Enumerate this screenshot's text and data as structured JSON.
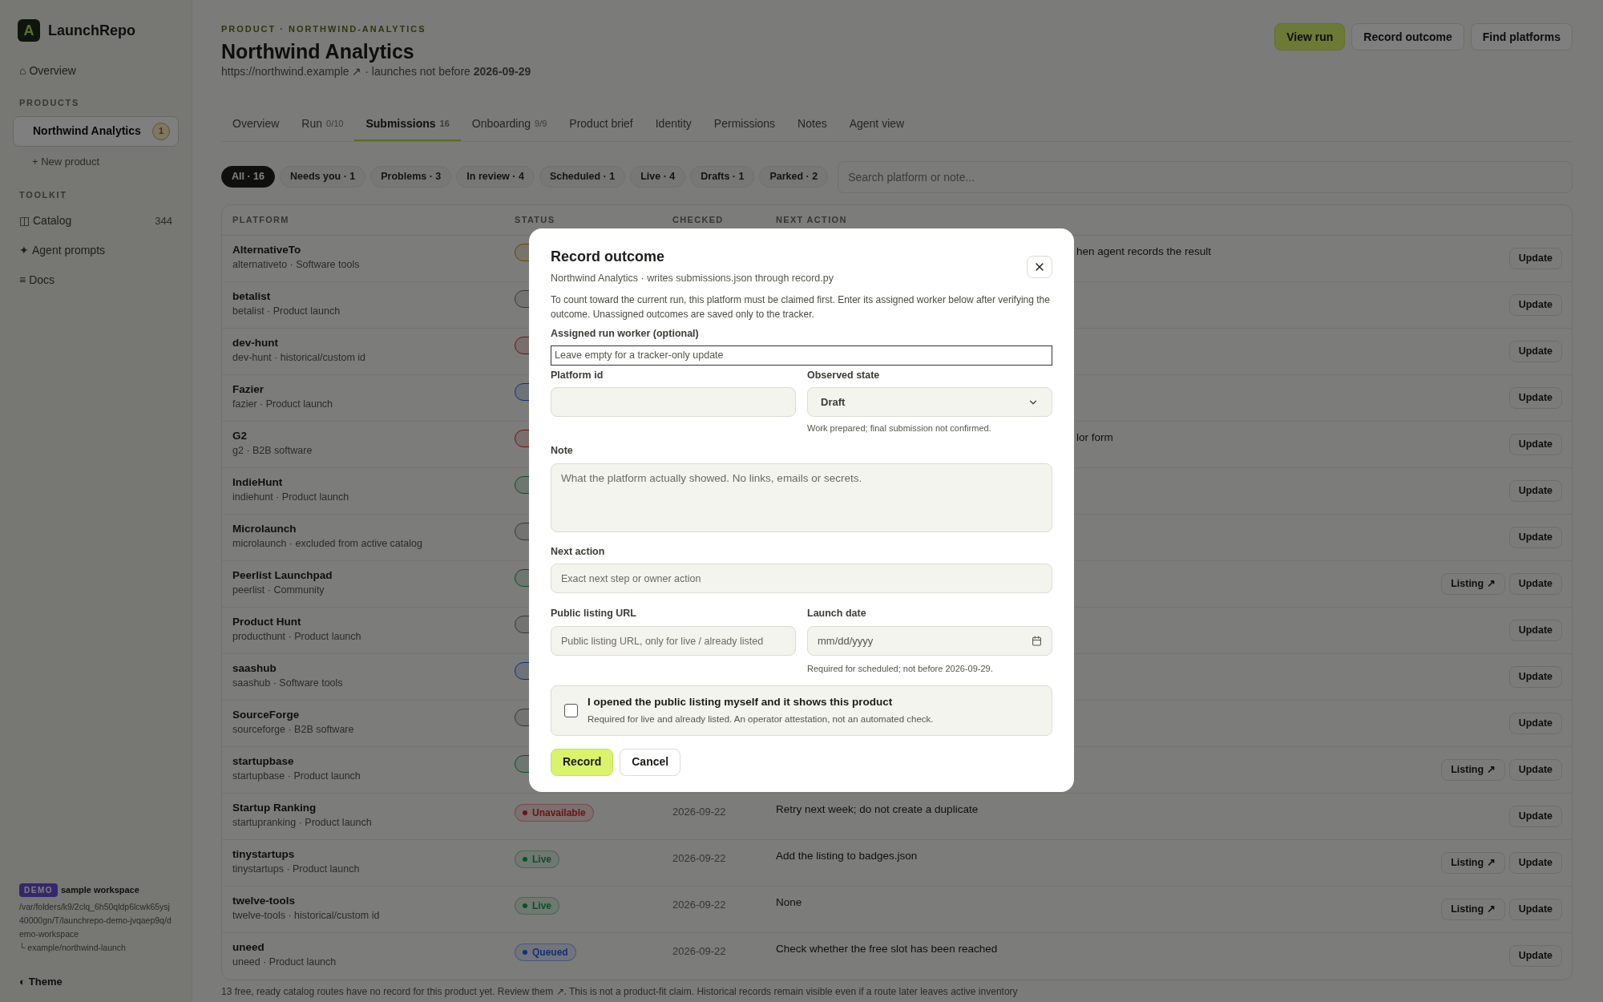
{
  "sidebar": {
    "brand": {
      "mark": "A",
      "name": "LaunchRepo"
    },
    "top_items": [
      {
        "icon": "⌂",
        "label": "Overview"
      }
    ],
    "products_heading": "PRODUCTS",
    "products": [
      {
        "label": "Northwind Analytics",
        "badge": "1",
        "selected": true
      }
    ],
    "new_product": "+ New product",
    "toolkit_heading": "TOOLKIT",
    "toolkit": [
      {
        "icon": "◫",
        "label": "Catalog",
        "count": "344"
      },
      {
        "icon": "✦",
        "label": "Agent prompts"
      },
      {
        "icon": "≡",
        "label": "Docs"
      }
    ],
    "workspace": {
      "badge": "DEMO",
      "title": "sample workspace",
      "path": "/var/folders/k9/2clq_6h50qldp6lcwk65ysj40000gn/T/launchrepo-demo-jvqaep9q/demo-workspace",
      "repo": "└ example/northwind-launch"
    },
    "theme": {
      "icon": "◐",
      "label": "Theme"
    }
  },
  "header": {
    "eyebrow": "PRODUCT · NORTHWIND-ANALYTICS",
    "title": "Northwind Analytics",
    "link": "https://northwind.example ↗",
    "meta": " · launches not before **2026-09-29**",
    "buttons": [
      {
        "label": "View run",
        "kind": "primary"
      },
      {
        "label": "Record outcome",
        "kind": "secondary"
      },
      {
        "label": "Find platforms",
        "kind": "secondary"
      }
    ]
  },
  "tabs": [
    {
      "label": "Overview",
      "selected": false
    },
    {
      "label": "Run",
      "count": "0/10",
      "selected": false
    },
    {
      "label": "Submissions",
      "count": "16",
      "selected": true
    },
    {
      "label": "Onboarding",
      "count": "9/9",
      "selected": false
    },
    {
      "label": "Product brief",
      "selected": false
    },
    {
      "label": "Identity",
      "selected": false
    },
    {
      "label": "Permissions",
      "selected": false
    },
    {
      "label": "Notes",
      "selected": false
    },
    {
      "label": "Agent view",
      "selected": false
    }
  ],
  "filters": [
    {
      "label": "All · 16",
      "selected": true
    },
    {
      "label": "Needs you · 1",
      "selected": false
    },
    {
      "label": "Problems · 3",
      "selected": false
    },
    {
      "label": "In review · 4",
      "selected": false
    },
    {
      "label": "Scheduled · 1",
      "selected": false
    },
    {
      "label": "Live · 4",
      "selected": false
    },
    {
      "label": "Drafts · 1",
      "selected": false
    },
    {
      "label": "Parked · 2",
      "selected": false
    }
  ],
  "search": {
    "placeholder": "Search platform or note..."
  },
  "table": {
    "columns": [
      "PLATFORM",
      "STATUS",
      "CHECKED",
      "NEXT ACTION"
    ],
    "rows": [
      {
        "name": "AlternativeTo",
        "sub": "alternativeto · Software tools",
        "status": {
          "kind": "warning"
        },
        "next_action_tail": "hen agent records the result",
        "actions": [
          "Update"
        ]
      },
      {
        "name": "betalist",
        "sub": "betalist · Product launch",
        "status": {
          "kind": "neutral"
        },
        "actions": [
          "Update"
        ]
      },
      {
        "name": "dev-hunt",
        "sub": "dev-hunt · historical/custom id",
        "status": {
          "kind": "danger"
        },
        "actions": [
          "Update"
        ]
      },
      {
        "name": "Fazier",
        "sub": "fazier · Product launch",
        "status": {
          "kind": "info"
        },
        "actions": [
          "Update"
        ]
      },
      {
        "name": "G2",
        "sub": "g2 · B2B software",
        "status": {
          "kind": "danger"
        },
        "next_action_tail": "lor form",
        "actions": [
          "Update"
        ]
      },
      {
        "name": "IndieHunt",
        "sub": "indiehunt · Product launch",
        "status": {
          "kind": "success"
        },
        "actions": [
          "Update"
        ]
      },
      {
        "name": "Microlaunch",
        "sub": "microlaunch · excluded from active catalog",
        "status": {
          "kind": "neutral"
        },
        "actions": [
          "Update"
        ]
      },
      {
        "name": "Peerlist Launchpad",
        "sub": "peerlist · Community",
        "status": {
          "kind": "success"
        },
        "actions": [
          "Listing ↗",
          "Update"
        ]
      },
      {
        "name": "Product Hunt",
        "sub": "producthunt · Product launch",
        "status": {
          "kind": "neutral"
        },
        "actions": [
          "Update"
        ]
      },
      {
        "name": "saashub",
        "sub": "saashub · Software tools",
        "status": {
          "kind": "info"
        },
        "actions": [
          "Update"
        ]
      },
      {
        "name": "SourceForge",
        "sub": "sourceforge · B2B software",
        "status": {
          "kind": "neutral"
        },
        "actions": [
          "Update"
        ]
      },
      {
        "name": "startupbase",
        "sub": "startupbase · Product launch",
        "status": {
          "kind": "success"
        },
        "actions": [
          "Listing ↗",
          "Update"
        ]
      },
      {
        "name": "Startup Ranking",
        "sub": "startupranking · Product launch",
        "status": {
          "label": "Unavailable",
          "kind": "danger"
        },
        "checked": "2026-09-22",
        "next_action": "Retry next week; do not create a duplicate",
        "actions": [
          "Update"
        ]
      },
      {
        "name": "tinystartups",
        "sub": "tinystartups · Product launch",
        "status": {
          "label": "Live",
          "kind": "success"
        },
        "checked": "2026-09-22",
        "next_action": "Add the listing to badges.json",
        "actions": [
          "Listing ↗",
          "Update"
        ]
      },
      {
        "name": "twelve-tools",
        "sub": "twelve-tools · historical/custom id",
        "status": {
          "label": "Live",
          "kind": "success"
        },
        "checked": "2026-09-22",
        "next_action": "None",
        "actions": [
          "Listing ↗",
          "Update"
        ]
      },
      {
        "name": "uneed",
        "sub": "uneed · Product launch",
        "status": {
          "label": "Queued",
          "kind": "info"
        },
        "checked": "2026-09-22",
        "next_action": "Check whether the free slot has been reached",
        "actions": [
          "Update"
        ]
      }
    ]
  },
  "footer_note": "13 free, ready catalog routes have no record for this product yet. Review them ↗. This is not a product-fit claim. Historical records remain visible even if a route later leaves active inventory",
  "dialog": {
    "title": "Record outcome",
    "subtitle": "Northwind Analytics · writes submissions.json through record.py",
    "intro": "To count toward the current run, this platform must be claimed first. Enter its assigned worker below after verifying the outcome. Unassigned outcomes are saved only to the tracker.",
    "worker": {
      "label": "Assigned run worker (optional)",
      "placeholder": "Leave empty for a tracker-only update"
    },
    "platform_id": {
      "label": "Platform id"
    },
    "observed_state": {
      "label": "Observed state",
      "value": "Draft",
      "help": "Work prepared; final submission not confirmed."
    },
    "note": {
      "label": "Note",
      "placeholder": "What the platform actually showed. No links, emails or secrets."
    },
    "next_action": {
      "label": "Next action",
      "placeholder": "Exact next step or owner action"
    },
    "listing_url": {
      "label": "Public listing URL",
      "placeholder": "Public listing URL, only for live / already listed"
    },
    "launch_date": {
      "label": "Launch date",
      "placeholder": "mm/dd/yyyy",
      "help": "Required for scheduled; not before 2026-09-29."
    },
    "attestation": {
      "checked": false,
      "label": "I opened the public listing myself and it shows this product",
      "help": "Required for live and already listed. An operator attestation, not an automated check."
    },
    "buttons": [
      {
        "label": "Record",
        "kind": "primary"
      },
      {
        "label": "Cancel",
        "kind": "secondary"
      }
    ]
  }
}
